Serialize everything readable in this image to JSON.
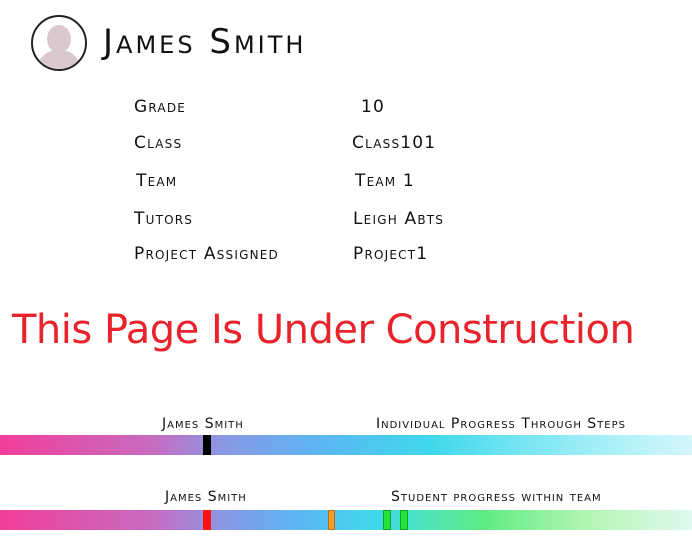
{
  "profile": {
    "name": "James Smith",
    "avatar_icon": "user-silhouette-icon"
  },
  "info": [
    {
      "label": "Grade",
      "value": "10"
    },
    {
      "label": "Class",
      "value": "Class101"
    },
    {
      "label": "Team",
      "value": "Team 1"
    },
    {
      "label": "Tutors",
      "value": "Leigh Abts"
    },
    {
      "label": "Project Assigned",
      "value": "Project1"
    }
  ],
  "banner": {
    "text": "This Page Is Under Construction",
    "color": "#e8232b"
  },
  "individual_progress": {
    "student_label": "James Smith",
    "title": "Individual Progress Through Steps",
    "marker_color": "#000000"
  },
  "team_progress": {
    "student_label": "James Smith",
    "title": "Student progress within team",
    "marker_colors": [
      "#ff1111",
      "#f59d2a",
      "#22e43d",
      "#22e43d"
    ]
  }
}
